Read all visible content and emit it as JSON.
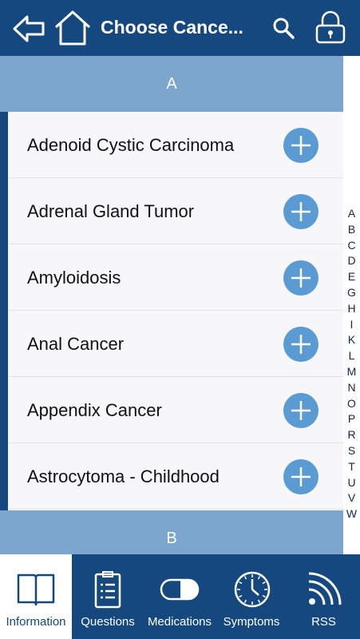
{
  "header": {
    "title": "Choose Cance...",
    "back_icon": "back-arrow-icon",
    "home_icon": "home-icon",
    "search_icon": "search-icon",
    "lock_icon": "lock-icon"
  },
  "sections": [
    {
      "letter": "A"
    },
    {
      "letter": "B"
    }
  ],
  "items": [
    {
      "label": "Adenoid Cystic Carcinoma"
    },
    {
      "label": "Adrenal Gland Tumor"
    },
    {
      "label": "Amyloidosis"
    },
    {
      "label": "Anal Cancer"
    },
    {
      "label": "Appendix Cancer"
    },
    {
      "label": "Astrocytoma - Childhood"
    }
  ],
  "index_letters": [
    "A",
    "B",
    "C",
    "D",
    "E",
    "G",
    "H",
    "I",
    "K",
    "L",
    "M",
    "N",
    "O",
    "P",
    "R",
    "S",
    "T",
    "U",
    "V",
    "W"
  ],
  "tabs": [
    {
      "label": "Information",
      "icon": "book-icon",
      "active": true
    },
    {
      "label": "Questions",
      "icon": "clipboard-icon",
      "active": false
    },
    {
      "label": "Medications",
      "icon": "pill-icon",
      "active": false
    },
    {
      "label": "Symptoms",
      "icon": "clock-icon",
      "active": false
    },
    {
      "label": "RSS",
      "icon": "rss-icon",
      "active": false
    }
  ],
  "colors": {
    "brand": "#14487f",
    "section": "#7ca6cd",
    "add_button": "#5a9bd3"
  }
}
